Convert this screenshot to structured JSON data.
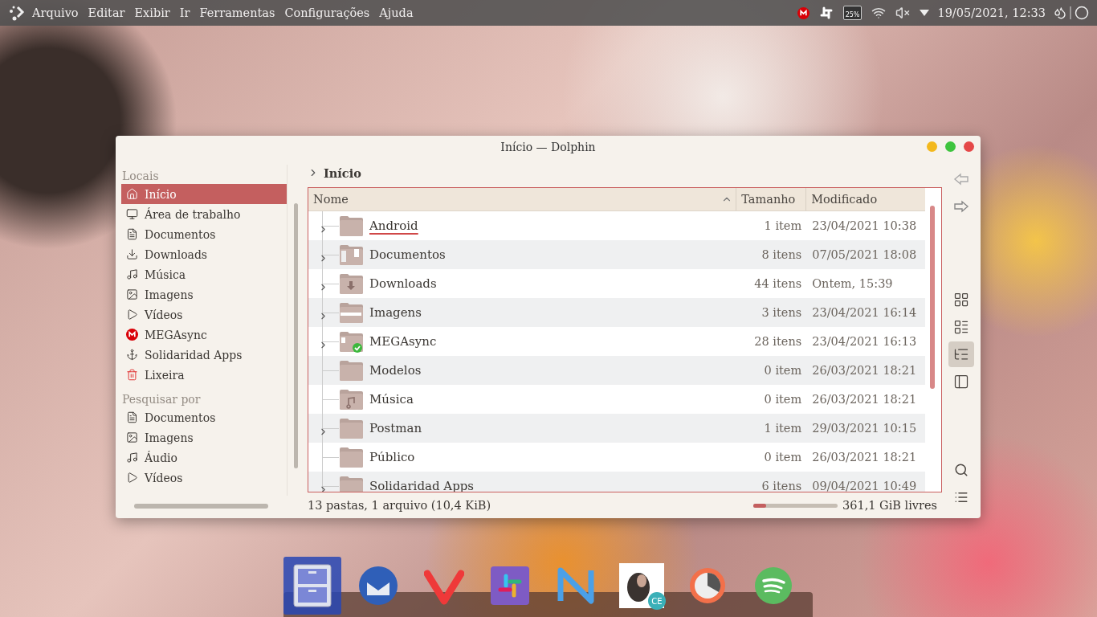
{
  "top_bar": {
    "menu": [
      "Arquivo",
      "Editar",
      "Exibir",
      "Ir",
      "Ferramentas",
      "Configurações",
      "Ajuda"
    ],
    "battery": "25%",
    "clock": "19/05/2021, 12:33"
  },
  "window": {
    "title": "Início — Dolphin",
    "sidebar": {
      "sections": [
        {
          "heading": "Locais",
          "items": [
            {
              "label": "Início",
              "kind": "home",
              "selected": true
            },
            {
              "label": "Área de trabalho",
              "kind": "desktop",
              "selected": false
            },
            {
              "label": "Documentos",
              "kind": "document",
              "selected": false
            },
            {
              "label": "Downloads",
              "kind": "download",
              "selected": false
            },
            {
              "label": "Música",
              "kind": "music",
              "selected": false
            },
            {
              "label": "Imagens",
              "kind": "image",
              "selected": false
            },
            {
              "label": "Vídeos",
              "kind": "video",
              "selected": false
            },
            {
              "label": "MEGAsync",
              "kind": "mega",
              "selected": false
            },
            {
              "label": "Solidaridad Apps",
              "kind": "anchor",
              "selected": false
            },
            {
              "label": "Lixeira",
              "kind": "trash",
              "selected": false
            }
          ]
        },
        {
          "heading": "Pesquisar por",
          "items": [
            {
              "label": "Documentos",
              "kind": "document",
              "selected": false
            },
            {
              "label": "Imagens",
              "kind": "image",
              "selected": false
            },
            {
              "label": "Áudio",
              "kind": "music",
              "selected": false
            },
            {
              "label": "Vídeos",
              "kind": "video",
              "selected": false
            }
          ]
        }
      ]
    },
    "breadcrumb": "Início",
    "columns": [
      "Nome",
      "Tamanho",
      "Modificado"
    ],
    "rows": [
      {
        "name": "Android",
        "size": "1 item",
        "modified": "23/04/2021 10:38",
        "kind": "plain",
        "expandable": true,
        "focused": true
      },
      {
        "name": "Documentos",
        "size": "8 itens",
        "modified": "07/05/2021 18:08",
        "kind": "documents",
        "expandable": true,
        "focused": false
      },
      {
        "name": "Downloads",
        "size": "44 itens",
        "modified": "Ontem, 15:39",
        "kind": "downloads",
        "expandable": true,
        "focused": false
      },
      {
        "name": "Imagens",
        "size": "3 itens",
        "modified": "23/04/2021 16:14",
        "kind": "images",
        "expandable": true,
        "focused": false
      },
      {
        "name": "MEGAsync",
        "size": "28 itens",
        "modified": "23/04/2021 16:13",
        "kind": "mega",
        "expandable": true,
        "focused": false
      },
      {
        "name": "Modelos",
        "size": "0 item",
        "modified": "26/03/2021 18:21",
        "kind": "plain",
        "expandable": false,
        "focused": false
      },
      {
        "name": "Música",
        "size": "0 item",
        "modified": "26/03/2021 18:21",
        "kind": "music",
        "expandable": false,
        "focused": false
      },
      {
        "name": "Postman",
        "size": "1 item",
        "modified": "29/03/2021 10:15",
        "kind": "plain",
        "expandable": true,
        "focused": false
      },
      {
        "name": "Público",
        "size": "0 item",
        "modified": "26/03/2021 18:21",
        "kind": "plain",
        "expandable": false,
        "focused": false
      },
      {
        "name": "Solidaridad Apps",
        "size": "6 itens",
        "modified": "09/04/2021 10:49",
        "kind": "plain",
        "expandable": true,
        "focused": false
      }
    ],
    "views": [
      {
        "kind": "icons",
        "selected": false
      },
      {
        "kind": "compact",
        "selected": false
      },
      {
        "kind": "details",
        "selected": true
      },
      {
        "kind": "split",
        "selected": false
      }
    ],
    "status": "13 pastas, 1 arquivo (10,4 KiB)",
    "disk": {
      "level": 0.15,
      "free": "361,1 GiB livres"
    }
  },
  "dock": [
    {
      "kind": "files",
      "active": true
    },
    {
      "kind": "mail",
      "active": false
    },
    {
      "kind": "vivaldi",
      "active": false
    },
    {
      "kind": "slack",
      "active": false
    },
    {
      "kind": "meld",
      "active": false
    },
    {
      "kind": "beaver",
      "active": false,
      "badge": "CE"
    },
    {
      "kind": "clock",
      "active": false
    },
    {
      "kind": "spotify",
      "active": false
    }
  ]
}
